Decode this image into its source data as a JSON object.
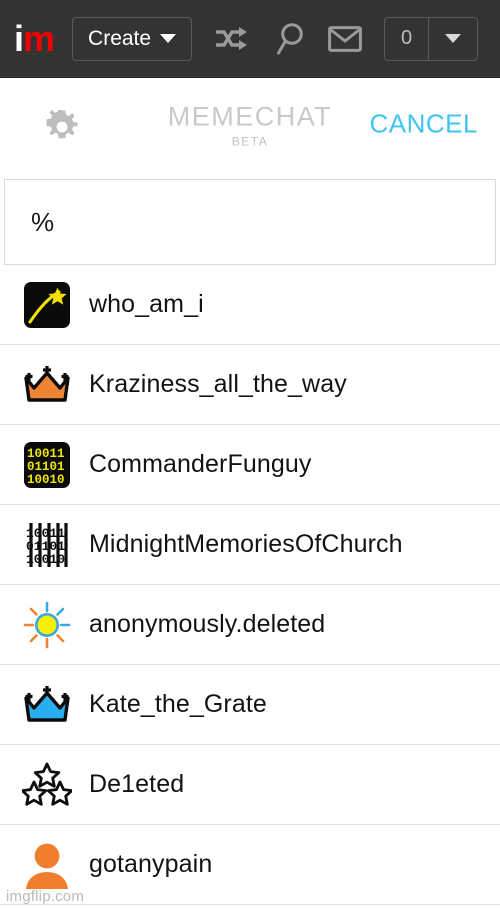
{
  "topnav": {
    "logo_i": "i",
    "logo_m": "m",
    "create_label": "Create",
    "shuffle_icon": "shuffle-icon",
    "search_icon": "search-icon",
    "mail_icon": "envelope-icon",
    "points_value": "0",
    "points_caret_icon": "chevron-down-icon",
    "bg_color": "#333333",
    "logo_accent_color": "#f00000"
  },
  "subheader": {
    "gear_icon": "gear-icon",
    "title": "MEMECHAT",
    "subtitle": "BETA",
    "cancel_label": "CANCEL",
    "cancel_color": "#3ec6f0",
    "title_color": "#c9c9c9"
  },
  "search": {
    "value": "%",
    "placeholder": "Search"
  },
  "users": [
    {
      "name": "who_am_i",
      "avatar": "shooting-star-avatar"
    },
    {
      "name": "Kraziness_all_the_way",
      "avatar": "orange-crown-avatar"
    },
    {
      "name": "CommanderFunguy",
      "avatar": "yellow-binary-avatar"
    },
    {
      "name": "MidnightMemoriesOfChurch",
      "avatar": "black-binary-avatar"
    },
    {
      "name": "anonymously.deleted",
      "avatar": "sun-avatar"
    },
    {
      "name": "Kate_the_Grate",
      "avatar": "blue-crown-avatar"
    },
    {
      "name": "De1eted",
      "avatar": "three-stars-avatar"
    },
    {
      "name": "gotanypain",
      "avatar": "orange-person-avatar"
    }
  ],
  "watermark": {
    "text": "imgflip.com"
  }
}
